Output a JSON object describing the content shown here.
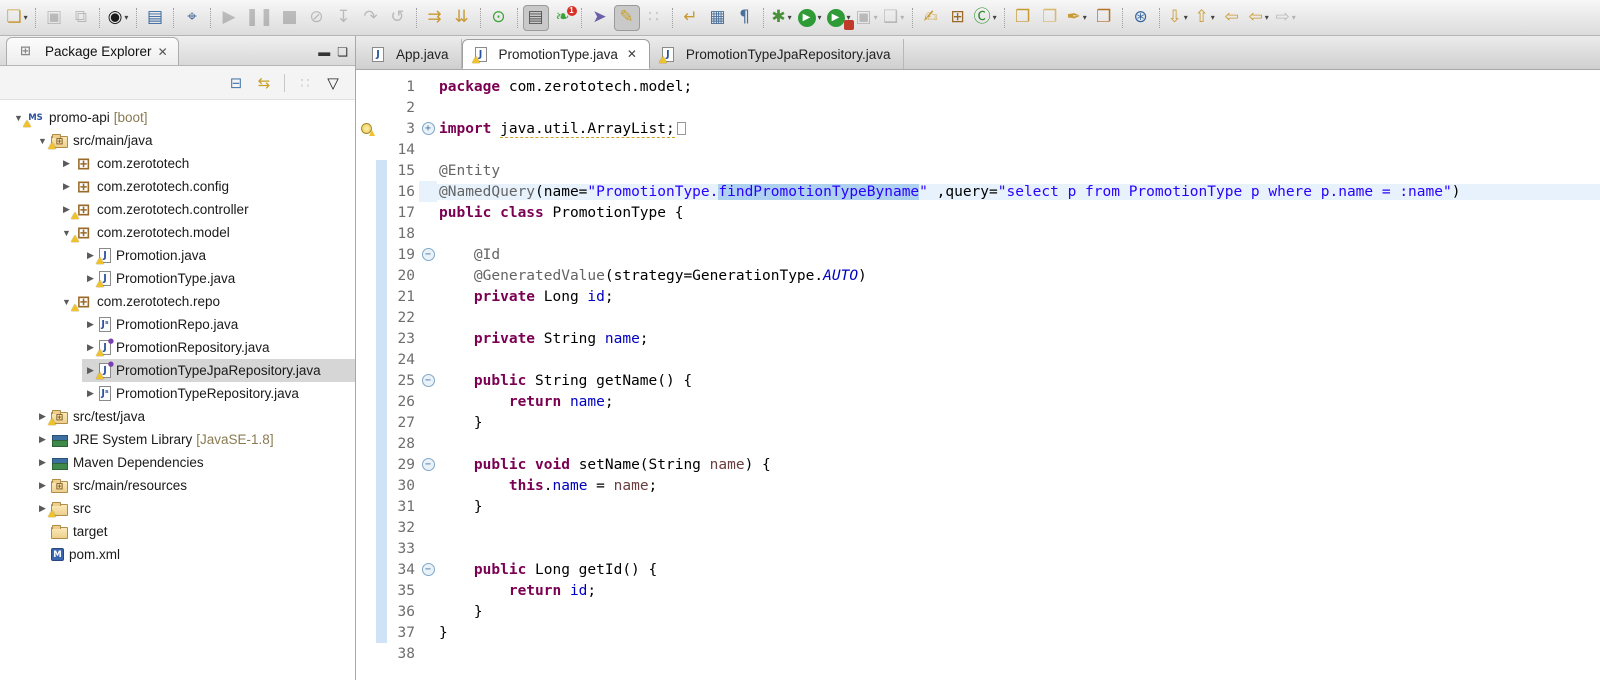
{
  "toolbar": {
    "items": [
      {
        "name": "new-wizard-button",
        "glyph": "❏",
        "color": "#c89a35",
        "dropdown": true
      },
      {
        "sep": true
      },
      {
        "name": "save-button",
        "glyph": "▣",
        "color": "#555",
        "disabled": true
      },
      {
        "name": "save-all-button",
        "glyph": "⧉",
        "color": "#555",
        "disabled": true
      },
      {
        "sep": true
      },
      {
        "name": "user-account-button",
        "glyph": "◉",
        "color": "#1a1a1a",
        "dropdown": true
      },
      {
        "sep": true
      },
      {
        "name": "open-terminal-button",
        "glyph": "▤",
        "color": "#3565a0"
      },
      {
        "sep": true
      },
      {
        "name": "pin-editor-button",
        "glyph": "⌖",
        "color": "#4a6f9a"
      },
      {
        "sep": true
      },
      {
        "name": "resume-button",
        "glyph": "▶",
        "color": "#555",
        "disabled": true
      },
      {
        "name": "suspend-button",
        "glyph": "❚❚",
        "color": "#555",
        "disabled": true
      },
      {
        "name": "terminate-button",
        "glyph": "■",
        "color": "#555",
        "disabled": true
      },
      {
        "name": "disconnect-button",
        "glyph": "⊘",
        "color": "#555",
        "disabled": true
      },
      {
        "name": "step-into-button",
        "glyph": "↧",
        "color": "#555",
        "disabled": true
      },
      {
        "name": "step-over-button",
        "glyph": "↷",
        "color": "#555",
        "disabled": true
      },
      {
        "name": "step-return-button",
        "glyph": "↺",
        "color": "#555",
        "disabled": true
      },
      {
        "sep": true
      },
      {
        "name": "format-tool-button",
        "glyph": "⇉",
        "color": "#c89a35"
      },
      {
        "name": "sort-members-button",
        "glyph": "⇊",
        "color": "#c89a35"
      },
      {
        "sep": true
      },
      {
        "name": "spring-boot-dashboard-button",
        "glyph": "⊙",
        "color": "#3aa336"
      },
      {
        "sep": true
      },
      {
        "name": "toggle-line-numbers-button",
        "glyph": "▤",
        "color": "#555",
        "pressed": true
      },
      {
        "name": "spring-insight-button",
        "glyph": "❧",
        "color": "#3aa336",
        "badge": "1"
      },
      {
        "sep": true
      },
      {
        "name": "select-tool-button",
        "glyph": "➤",
        "color": "#6a5fa8"
      },
      {
        "name": "highlighter-button",
        "glyph": "✎",
        "color": "#c8a028",
        "pressed": true
      },
      {
        "name": "smart-insert-button",
        "glyph": "∷",
        "color": "#777",
        "disabled": true
      },
      {
        "sep": true
      },
      {
        "name": "open-console-button",
        "glyph": "↵",
        "color": "#c89a35"
      },
      {
        "name": "block-selection-button",
        "glyph": "▦",
        "color": "#4a6f9a"
      },
      {
        "name": "show-whitespace-button",
        "glyph": "¶",
        "color": "#4a6f9a"
      },
      {
        "sep": true
      },
      {
        "name": "debug-button",
        "glyph": "✱",
        "color": "#4a8f3a",
        "dropdown": true
      },
      {
        "name": "run-button",
        "glyph": "▶",
        "color": "#ffffff",
        "circle": "#2e9b37",
        "dropdown": true
      },
      {
        "name": "coverage-button",
        "glyph": "▶",
        "color": "#ffffff",
        "circle": "#2e9b37",
        "badge_sq": "​",
        "dropdown": true
      },
      {
        "name": "profile-button",
        "glyph": "▣",
        "color": "#555",
        "disabled": true,
        "dropdown": true
      },
      {
        "name": "external-tools-button",
        "glyph": "❑",
        "color": "#555",
        "disabled": true,
        "dropdown": true
      },
      {
        "sep": true
      },
      {
        "name": "new-java-element-button",
        "glyph": "✍",
        "color": "#c89a35"
      },
      {
        "name": "new-package-button",
        "glyph": "⊞",
        "color": "#9a6a2a"
      },
      {
        "name": "new-class-button",
        "glyph": "Ⓒ",
        "color": "#2e8b2e",
        "dropdown": true
      },
      {
        "sep": true
      },
      {
        "name": "open-type-button",
        "glyph": "❐",
        "color": "#c89a35"
      },
      {
        "name": "open-resource-button",
        "glyph": "❐",
        "color": "#d8b86a"
      },
      {
        "name": "annotation-pen-button",
        "glyph": "✒",
        "color": "#c89a35",
        "dropdown": true
      },
      {
        "name": "search-button",
        "glyph": "❐",
        "color": "#b5722a"
      },
      {
        "sep": true
      },
      {
        "name": "web-browser-button",
        "glyph": "⊛",
        "color": "#3565a0"
      },
      {
        "sep": true
      },
      {
        "name": "next-annotation-button",
        "glyph": "⇩",
        "color": "#c89a35",
        "dropdown": true
      },
      {
        "name": "previous-annotation-button",
        "glyph": "⇧",
        "color": "#c89a35",
        "dropdown": true
      },
      {
        "name": "last-edit-location-button",
        "glyph": "⇦",
        "color": "#c89a35"
      },
      {
        "name": "back-button",
        "glyph": "⇦",
        "color": "#c89a35",
        "dropdown": true
      },
      {
        "name": "forward-button",
        "glyph": "⇨",
        "color": "#555",
        "disabled": true,
        "dropdown": true
      }
    ]
  },
  "explorer": {
    "title": "Package Explorer",
    "close_glyph": "✕",
    "minimize_glyph": "▬",
    "maximize_glyph": "❏",
    "view_icon_glyph": "⊞",
    "view_toolbar": [
      {
        "name": "collapse-all-button",
        "glyph": "⊟",
        "color": "#4f7fae"
      },
      {
        "name": "link-with-editor-button",
        "glyph": "⇆",
        "color": "#c8a028"
      },
      {
        "sep": true
      },
      {
        "name": "focus-on-active-task-button",
        "glyph": "∷",
        "color": "#999",
        "disabled": true
      },
      {
        "name": "view-menu-button",
        "glyph": "▽",
        "color": "#222"
      }
    ],
    "icons": {
      "mvn": "MS",
      "pkg": "⊞",
      "srcfolder": "⊞",
      "folder": "",
      "jfile": "J",
      "jfile_s": "Jˢ",
      "jfile_i": "J",
      "lib": "",
      "mfile": "M"
    },
    "tree": [
      {
        "label": "promo-api",
        "suffix": "[boot]",
        "level": 0,
        "arrow": "down",
        "icon": "mvn",
        "warn": true
      },
      {
        "label": "src/main/java",
        "level": 1,
        "arrow": "down",
        "icon": "srcfolder",
        "warn": true
      },
      {
        "label": "com.zerototech",
        "level": 2,
        "arrow": "right",
        "icon": "pkg"
      },
      {
        "label": "com.zerototech.config",
        "level": 2,
        "arrow": "right",
        "icon": "pkg"
      },
      {
        "label": "com.zerototech.controller",
        "level": 2,
        "arrow": "right",
        "icon": "pkg",
        "warn": true
      },
      {
        "label": "com.zerototech.model",
        "level": 2,
        "arrow": "down",
        "icon": "pkg",
        "warn": true
      },
      {
        "label": "Promotion.java",
        "level": 3,
        "arrow": "right",
        "icon": "jfile",
        "warn": true
      },
      {
        "label": "PromotionType.java",
        "level": 3,
        "arrow": "right",
        "icon": "jfile",
        "warn": true
      },
      {
        "label": "com.zerototech.repo",
        "level": 2,
        "arrow": "down",
        "icon": "pkg",
        "warn": true
      },
      {
        "label": "PromotionRepo.java",
        "level": 3,
        "arrow": "right",
        "icon": "jfile_s"
      },
      {
        "label": "PromotionRepository.java",
        "level": 3,
        "arrow": "right",
        "icon": "jfile_i",
        "warn": true
      },
      {
        "label": "PromotionTypeJpaRepository.java",
        "level": 3,
        "arrow": "right",
        "icon": "jfile_i",
        "warn": true,
        "selected": true
      },
      {
        "label": "PromotionTypeRepository.java",
        "level": 3,
        "arrow": "right",
        "icon": "jfile_s"
      },
      {
        "label": "src/test/java",
        "level": 1,
        "arrow": "right",
        "icon": "srcfolder",
        "warn": true
      },
      {
        "label": "JRE System Library",
        "suffix": "[JavaSE-1.8]",
        "level": 1,
        "arrow": "right",
        "icon": "lib"
      },
      {
        "label": "Maven Dependencies",
        "level": 1,
        "arrow": "right",
        "icon": "lib"
      },
      {
        "label": "src/main/resources",
        "level": 1,
        "arrow": "right",
        "icon": "srcfolder"
      },
      {
        "label": "src",
        "level": 1,
        "arrow": "right",
        "icon": "folder",
        "warn": true
      },
      {
        "label": "target",
        "level": 1,
        "arrow": "none",
        "icon": "folder"
      },
      {
        "label": "pom.xml",
        "level": 1,
        "arrow": "none",
        "icon": "mfile"
      }
    ]
  },
  "editor": {
    "tabs": [
      {
        "label": "App.java",
        "active": false,
        "warn": false
      },
      {
        "label": "PromotionType.java",
        "active": true,
        "warn": true,
        "close_glyph": "✕"
      },
      {
        "label": "PromotionTypeJpaRepository.java",
        "active": false,
        "warn": true
      }
    ],
    "code_lines": [
      {
        "n": "1",
        "segs": [
          {
            "t": "package ",
            "c": "kw"
          },
          {
            "t": "com.zerototech.model;",
            "c": "pl"
          }
        ]
      },
      {
        "n": "2",
        "segs": []
      },
      {
        "n": "3",
        "fold": "plus",
        "bulb": true,
        "segs": [
          {
            "t": "import ",
            "c": "kw"
          },
          {
            "t": "java.util.ArrayList;",
            "c": "pl wu"
          },
          {
            "t": "",
            "c": "foldbox"
          }
        ]
      },
      {
        "n": "14",
        "segs": []
      },
      {
        "n": "15",
        "diff": true,
        "segs": [
          {
            "t": "@Entity",
            "c": "ann"
          }
        ]
      },
      {
        "n": "16",
        "diff": true,
        "cur": true,
        "segs": [
          {
            "t": "@NamedQuery",
            "c": "ann"
          },
          {
            "t": "(name=",
            "c": "pl"
          },
          {
            "t": "\"PromotionType.",
            "c": "str"
          },
          {
            "t": "findPromotionTypeByname",
            "c": "str sel"
          },
          {
            "t": "\"",
            "c": "str"
          },
          {
            "t": " ,query=",
            "c": "pl"
          },
          {
            "t": "\"select p from PromotionType p where p.name = :name\"",
            "c": "str"
          },
          {
            "t": ")",
            "c": "pl"
          }
        ]
      },
      {
        "n": "17",
        "diff": true,
        "segs": [
          {
            "t": "public class ",
            "c": "kw"
          },
          {
            "t": "PromotionType {",
            "c": "pl"
          }
        ]
      },
      {
        "n": "18",
        "diff": true,
        "segs": []
      },
      {
        "n": "19",
        "diff": true,
        "fold": "minus",
        "segs": [
          {
            "t": "    ",
            "c": "pl"
          },
          {
            "t": "@Id",
            "c": "ann"
          }
        ]
      },
      {
        "n": "20",
        "diff": true,
        "segs": [
          {
            "t": "    ",
            "c": "pl"
          },
          {
            "t": "@GeneratedValue",
            "c": "ann"
          },
          {
            "t": "(strategy=GenerationType.",
            "c": "pl"
          },
          {
            "t": "AUTO",
            "c": "sta"
          },
          {
            "t": ")",
            "c": "pl"
          }
        ]
      },
      {
        "n": "21",
        "diff": true,
        "segs": [
          {
            "t": "    ",
            "c": "pl"
          },
          {
            "t": "private ",
            "c": "kw"
          },
          {
            "t": "Long ",
            "c": "pl"
          },
          {
            "t": "id",
            "c": "fld"
          },
          {
            "t": ";",
            "c": "pl"
          }
        ]
      },
      {
        "n": "22",
        "diff": true,
        "segs": []
      },
      {
        "n": "23",
        "diff": true,
        "segs": [
          {
            "t": "    ",
            "c": "pl"
          },
          {
            "t": "private ",
            "c": "kw"
          },
          {
            "t": "String ",
            "c": "pl"
          },
          {
            "t": "name",
            "c": "fld"
          },
          {
            "t": ";",
            "c": "pl"
          }
        ]
      },
      {
        "n": "24",
        "diff": true,
        "segs": []
      },
      {
        "n": "25",
        "diff": true,
        "fold": "minus",
        "segs": [
          {
            "t": "    ",
            "c": "pl"
          },
          {
            "t": "public ",
            "c": "kw"
          },
          {
            "t": "String getName() {",
            "c": "pl"
          }
        ]
      },
      {
        "n": "26",
        "diff": true,
        "segs": [
          {
            "t": "        ",
            "c": "pl"
          },
          {
            "t": "return ",
            "c": "kw"
          },
          {
            "t": "name",
            "c": "fld"
          },
          {
            "t": ";",
            "c": "pl"
          }
        ]
      },
      {
        "n": "27",
        "diff": true,
        "segs": [
          {
            "t": "    }",
            "c": "pl"
          }
        ]
      },
      {
        "n": "28",
        "diff": true,
        "segs": []
      },
      {
        "n": "29",
        "diff": true,
        "fold": "minus",
        "segs": [
          {
            "t": "    ",
            "c": "pl"
          },
          {
            "t": "public void ",
            "c": "kw"
          },
          {
            "t": "setName(String ",
            "c": "pl"
          },
          {
            "t": "name",
            "c": "par"
          },
          {
            "t": ") {",
            "c": "pl"
          }
        ]
      },
      {
        "n": "30",
        "diff": true,
        "segs": [
          {
            "t": "        ",
            "c": "pl"
          },
          {
            "t": "this",
            "c": "kw"
          },
          {
            "t": ".",
            "c": "pl"
          },
          {
            "t": "name",
            "c": "fld"
          },
          {
            "t": " = ",
            "c": "pl"
          },
          {
            "t": "name",
            "c": "par"
          },
          {
            "t": ";",
            "c": "pl"
          }
        ]
      },
      {
        "n": "31",
        "diff": true,
        "segs": [
          {
            "t": "    }",
            "c": "pl"
          }
        ]
      },
      {
        "n": "32",
        "diff": true,
        "segs": []
      },
      {
        "n": "33",
        "diff": true,
        "segs": []
      },
      {
        "n": "34",
        "diff": true,
        "fold": "minus",
        "segs": [
          {
            "t": "    ",
            "c": "pl"
          },
          {
            "t": "public ",
            "c": "kw"
          },
          {
            "t": "Long getId() {",
            "c": "pl"
          }
        ]
      },
      {
        "n": "35",
        "diff": true,
        "segs": [
          {
            "t": "        ",
            "c": "pl"
          },
          {
            "t": "return ",
            "c": "kw"
          },
          {
            "t": "id",
            "c": "fld"
          },
          {
            "t": ";",
            "c": "pl"
          }
        ]
      },
      {
        "n": "36",
        "diff": true,
        "segs": [
          {
            "t": "    }",
            "c": "pl"
          }
        ]
      },
      {
        "n": "37",
        "diff": true,
        "segs": [
          {
            "t": "}",
            "c": "pl"
          }
        ]
      },
      {
        "n": "38",
        "segs": []
      }
    ]
  },
  "colors": {
    "keyword": "#7B0052",
    "string": "#2A00FF",
    "annotation": "#646464",
    "field": "#0000C0",
    "parameter": "#6A3E3E",
    "current_line": "#e7f2fc",
    "selection": "#aed1f0",
    "quick_diff": "#cfe2f6"
  }
}
